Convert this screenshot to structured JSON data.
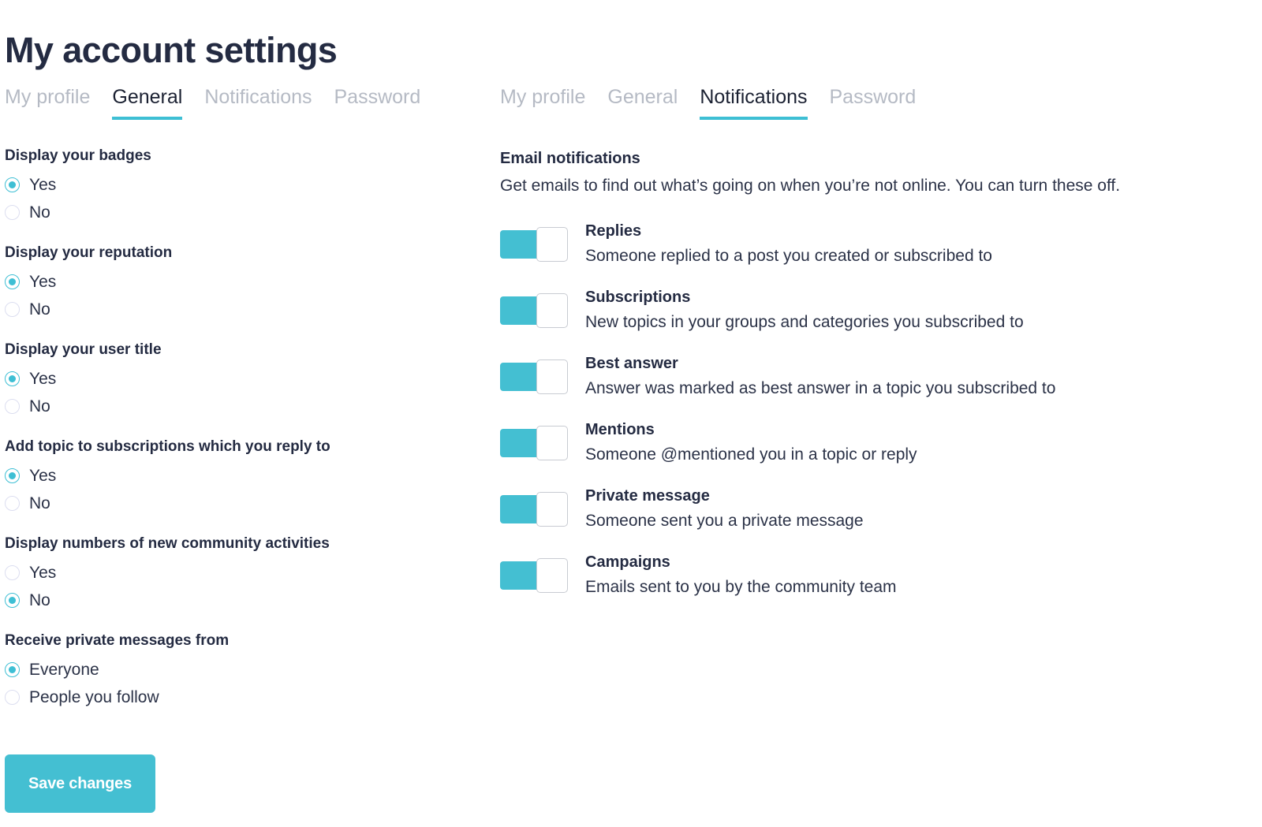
{
  "page": {
    "title": "My account settings"
  },
  "accent_color": "#44bfd2",
  "heading_color": "#242b42",
  "left_panel": {
    "tabs": [
      {
        "label": "My profile",
        "active": false
      },
      {
        "label": "General",
        "active": true
      },
      {
        "label": "Notifications",
        "active": false
      },
      {
        "label": "Password",
        "active": false
      }
    ],
    "groups": [
      {
        "label": "Display your badges",
        "options": [
          {
            "label": "Yes",
            "selected": true
          },
          {
            "label": "No",
            "selected": false
          }
        ]
      },
      {
        "label": "Display your reputation",
        "options": [
          {
            "label": "Yes",
            "selected": true
          },
          {
            "label": "No",
            "selected": false
          }
        ]
      },
      {
        "label": "Display your user title",
        "options": [
          {
            "label": "Yes",
            "selected": true
          },
          {
            "label": "No",
            "selected": false
          }
        ]
      },
      {
        "label": "Add topic to subscriptions which you reply to",
        "options": [
          {
            "label": "Yes",
            "selected": true
          },
          {
            "label": "No",
            "selected": false
          }
        ]
      },
      {
        "label": "Display numbers of new community activities",
        "options": [
          {
            "label": "Yes",
            "selected": false
          },
          {
            "label": "No",
            "selected": true
          }
        ]
      },
      {
        "label": "Receive private messages from",
        "options": [
          {
            "label": "Everyone",
            "selected": true
          },
          {
            "label": "People you follow",
            "selected": false
          }
        ]
      }
    ],
    "save_label": "Save changes"
  },
  "right_panel": {
    "tabs": [
      {
        "label": "My profile",
        "active": false
      },
      {
        "label": "General",
        "active": false
      },
      {
        "label": "Notifications",
        "active": true
      },
      {
        "label": "Password",
        "active": false
      }
    ],
    "section_title": "Email notifications",
    "section_desc": "Get emails to find out what’s going on when you’re not online. You can turn these off.",
    "notifications": [
      {
        "title": "Replies",
        "desc": "Someone replied to a post you created or subscribed to",
        "enabled": true
      },
      {
        "title": "Subscriptions",
        "desc": "New topics in your groups and categories you subscribed to",
        "enabled": true
      },
      {
        "title": "Best answer",
        "desc": "Answer was marked as best answer in a topic you subscribed to",
        "enabled": true
      },
      {
        "title": "Mentions",
        "desc": "Someone @mentioned you in a topic or reply",
        "enabled": true
      },
      {
        "title": "Private message",
        "desc": "Someone sent you a private message",
        "enabled": true
      },
      {
        "title": "Campaigns",
        "desc": "Emails sent to you by the community team",
        "enabled": true
      }
    ]
  }
}
